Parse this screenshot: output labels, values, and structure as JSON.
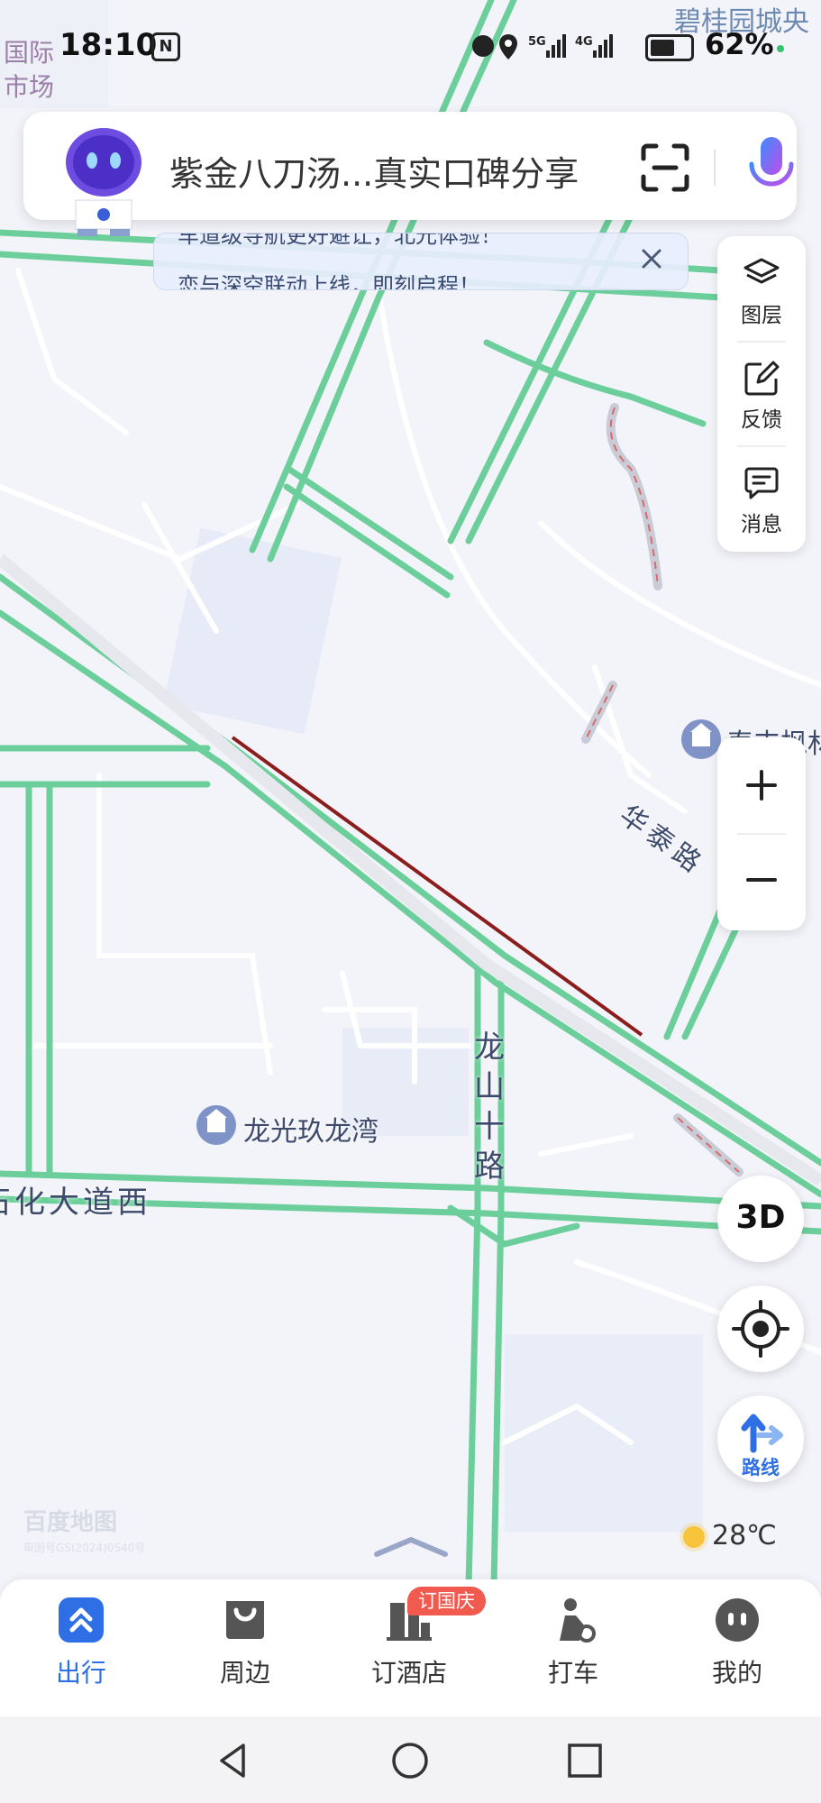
{
  "status_bar": {
    "time": "18:10",
    "nfc": "N",
    "network": "5G 4G",
    "battery": "62%"
  },
  "map": {
    "top_left_label_1": "国际",
    "top_left_label_2": "市场",
    "top_right_label": "碧桂园城央",
    "pois": [
      {
        "name": "龙光玖龙湾"
      },
      {
        "name": "泰丰枫林"
      }
    ],
    "roads": [
      "华泰路",
      "龙山十路",
      "石化大道西"
    ],
    "watermark": "百度地图",
    "watermark_small": "审图号GS(2024)0540号"
  },
  "search": {
    "query": "紫金八刀汤...真实口碑分享"
  },
  "notice": {
    "line1": "车道级导航更好避让，北光体验！",
    "line2": "恋与深空联动上线，即刻启程！"
  },
  "side_panel": {
    "layers": "图层",
    "feedback": "反馈",
    "messages": "消息"
  },
  "controls": {
    "three_d": "3D",
    "route": "路线",
    "zoom_in": "+",
    "zoom_out": "−"
  },
  "weather": {
    "temp": "28℃"
  },
  "tabs": [
    {
      "label": "出行",
      "icon": "travel-icon",
      "active": true
    },
    {
      "label": "周边",
      "icon": "nearby-icon"
    },
    {
      "label": "订酒店",
      "icon": "hotel-icon",
      "badge": "订国庆"
    },
    {
      "label": "打车",
      "icon": "taxi-icon"
    },
    {
      "label": "我的",
      "icon": "profile-icon"
    }
  ],
  "colors": {
    "accent": "#2f6fe6",
    "road_green": "#6ccf9b",
    "traffic_red": "#8b1d1d",
    "badge": "#f05a4f"
  }
}
